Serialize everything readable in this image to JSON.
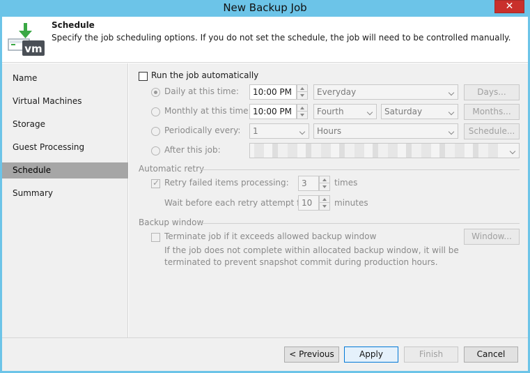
{
  "window": {
    "title": "New Backup Job",
    "close_glyph": "✕"
  },
  "header": {
    "title": "Schedule",
    "description": "Specify the job scheduling options. If you do not set the schedule, the job will need to be controlled manually.",
    "logo_text": "vm"
  },
  "sidebar": {
    "items": [
      {
        "label": "Name"
      },
      {
        "label": "Virtual Machines"
      },
      {
        "label": "Storage"
      },
      {
        "label": "Guest Processing"
      },
      {
        "label": "Schedule"
      },
      {
        "label": "Summary"
      }
    ],
    "active": "Schedule"
  },
  "schedule": {
    "run_auto_label": "Run the job automatically",
    "run_auto_checked": false,
    "daily": {
      "label": "Daily at this time:",
      "time": "10:00 PM",
      "days_value": "Everyday",
      "button": "Days...",
      "selected": true
    },
    "monthly": {
      "label": "Monthly at this time:",
      "time": "10:00 PM",
      "week_value": "Fourth",
      "day_value": "Saturday",
      "button": "Months..."
    },
    "periodic": {
      "label": "Periodically every:",
      "count": "1",
      "unit": "Hours",
      "button": "Schedule..."
    },
    "after": {
      "label": "After this job:"
    }
  },
  "retry": {
    "section": "Automatic retry",
    "retry_label": "Retry failed items processing:",
    "retry_checked": true,
    "retry_value": "3",
    "retry_unit": "times",
    "wait_label": "Wait before each retry attempt for:",
    "wait_value": "10",
    "wait_unit": "minutes"
  },
  "window_section": {
    "section": "Backup window",
    "terminate_label": "Terminate job if it exceeds allowed backup window",
    "terminate_checked": false,
    "button": "Window...",
    "note_line1": "If the job does not complete within allocated backup window, it will be",
    "note_line2": "terminated to prevent snapshot commit during production hours."
  },
  "footer": {
    "previous": "< Previous",
    "apply": "Apply",
    "finish": "Finish",
    "cancel": "Cancel"
  },
  "colors": {
    "accent": "#0078d7",
    "titlebar": "#6cc4e8",
    "close": "#c9302c",
    "logo_green": "#3aa845"
  }
}
